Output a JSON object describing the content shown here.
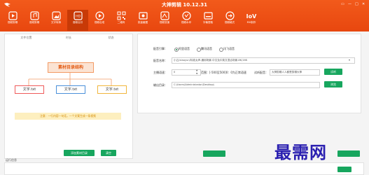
{
  "header": {
    "app_title": "大神剪辑 10.12.31",
    "toolbar": [
      {
        "label": "视频剪辑",
        "icon": "film-icon"
      },
      {
        "label": "音频剪辑",
        "icon": "music-icon"
      },
      {
        "label": "文字转换",
        "icon": "image-icon"
      },
      {
        "label": "音频合并",
        "icon": "hd-icon",
        "active": true
      },
      {
        "label": "视频合成",
        "icon": "play-icon"
      },
      {
        "label": "二维码",
        "icon": "qrcode-icon"
      },
      {
        "label": "批量截图",
        "icon": "screenshot-icon"
      },
      {
        "label": "视频变速",
        "icon": "speed-icon"
      },
      {
        "label": "视频水印",
        "icon": "watermark-icon"
      },
      {
        "label": "字幕提取",
        "icon": "subtitle-icon"
      },
      {
        "label": "视频格式",
        "icon": "format-icon"
      },
      {
        "label": "MV制作",
        "icon": "iov-icon",
        "glyph": "IoV"
      }
    ]
  },
  "left_panel": {
    "columns": [
      "文件位置",
      "时长",
      "状态"
    ],
    "diagram": {
      "root": "素材目录结构",
      "children": [
        "文字.txt",
        "文字.txt",
        "文字.txt"
      ]
    },
    "note": "注意：一行内容一句话，一个文案生成一条视频",
    "buttons": {
      "add": "添加素材目录",
      "clear": "清空"
    }
  },
  "right_panel": {
    "voice_engine": {
      "label": "配音引擎：",
      "options": [
        "阿里语音",
        "腾讯语音",
        "讯飞语音"
      ],
      "selected": 0
    },
    "voice_name": {
      "label": "配音名称：",
      "value": "小云/xiaoyun/标准女声-通用场景-中文及中英文混合场景-8K/16K"
    },
    "speed": {
      "label": "主播语速：",
      "value": "0",
      "range_label": "范围：[-500至500]0：0为正常语速",
      "try_label": "试听配音：",
      "try_value": "大神剪辑人人都是剪辑大神",
      "button": "试听"
    },
    "output": {
      "label": "输出目录：",
      "value": "C:\\Users\\Administrator\\Desktop\\",
      "button": "浏览"
    }
  },
  "bottom": {
    "label": "运行信息"
  },
  "watermark": "最需网",
  "colors": {
    "header": "#ec4f14",
    "accent_green": "#17a65e",
    "note_bg": "#fdefbf",
    "watermark": "#2a1fb0"
  }
}
